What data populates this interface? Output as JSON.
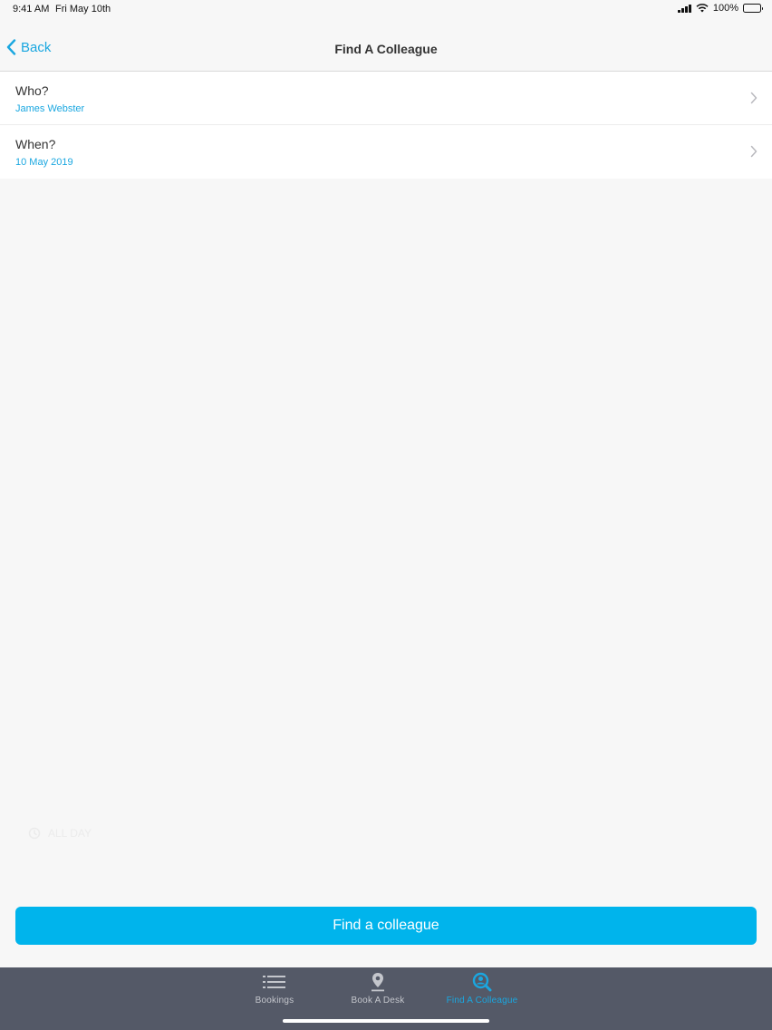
{
  "status_bar": {
    "time": "9:41 AM",
    "date": "Fri May 10th",
    "battery": "100%"
  },
  "nav": {
    "back_label": "Back",
    "title": "Find A Colleague"
  },
  "rows": [
    {
      "label": "Who?",
      "value": "James Webster"
    },
    {
      "label": "When?",
      "value": "10 May 2019"
    }
  ],
  "all_day_label": "ALL DAY",
  "primary_button_label": "Find a colleague",
  "tabs": [
    {
      "label": "Bookings",
      "icon": "list-icon",
      "active": false
    },
    {
      "label": "Book A Desk",
      "icon": "location-pin-icon",
      "active": false
    },
    {
      "label": "Find A Colleague",
      "icon": "user-search-icon",
      "active": true
    }
  ],
  "colors": {
    "accent": "#00b4ec",
    "link": "#1aa7e0",
    "tab_bar": "#545967",
    "background": "#f7f7f7"
  }
}
